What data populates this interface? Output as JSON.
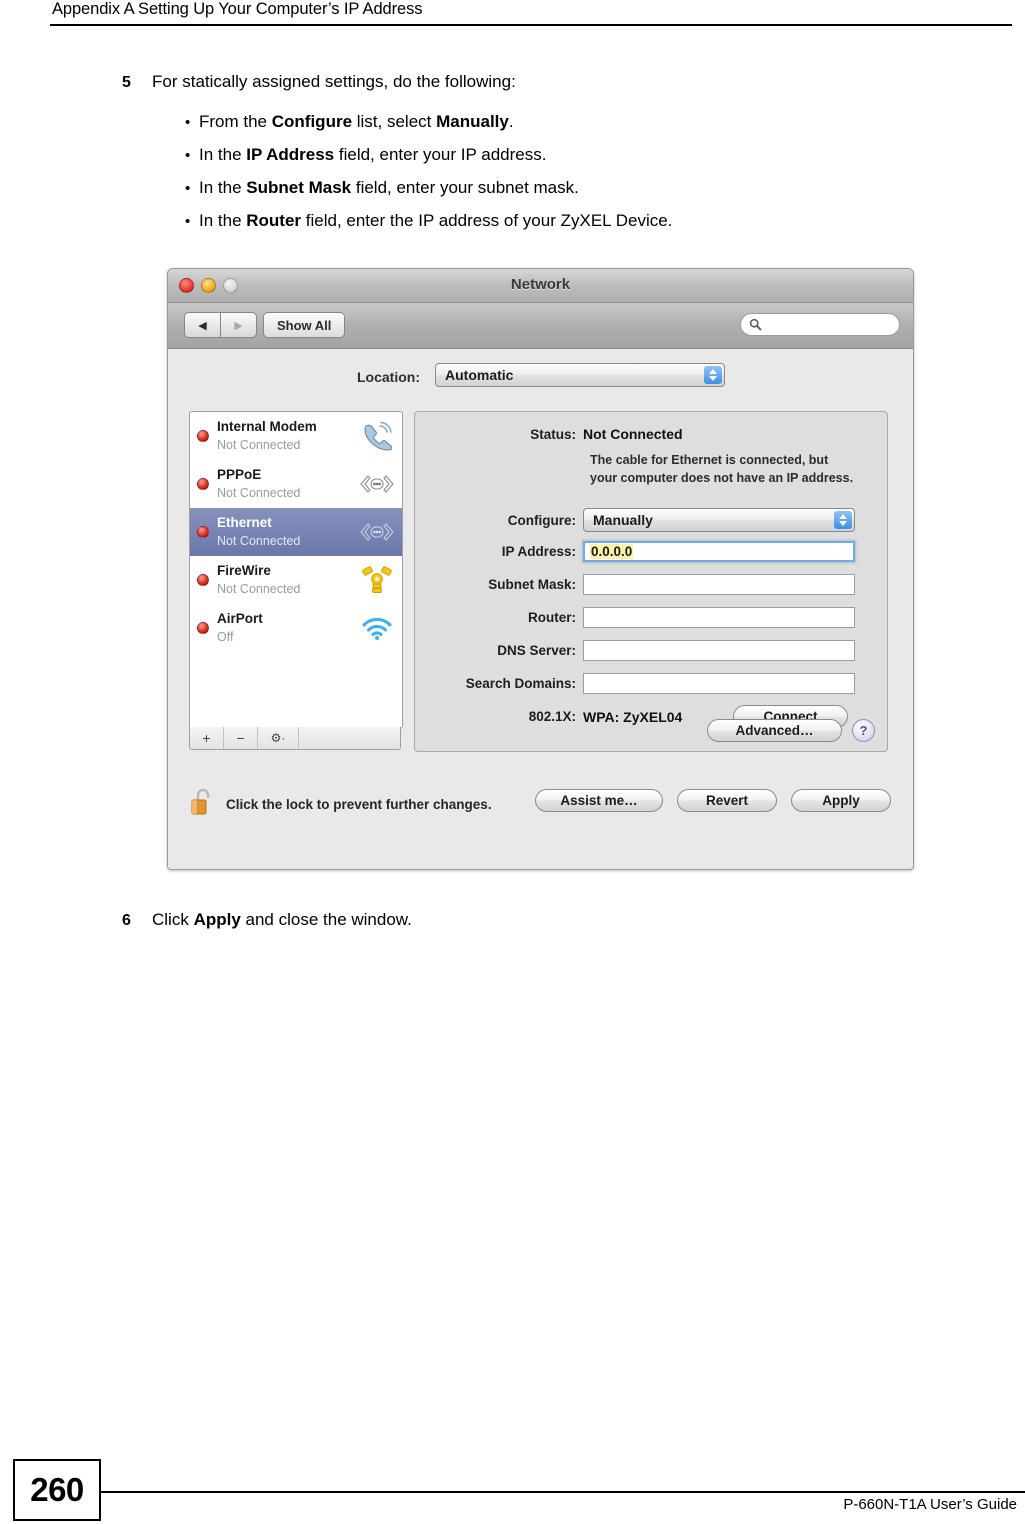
{
  "page_header": {
    "title": "Appendix A Setting Up Your Computer’s IP Address"
  },
  "steps": {
    "step5": {
      "number": "5",
      "text": "For statically assigned settings, do the following:",
      "bullets": [
        {
          "dot": "•",
          "pre": "From the ",
          "bold1": "Configure",
          "mid": " list, select ",
          "bold2": "Manually",
          "post": "."
        },
        {
          "dot": "•",
          "pre": "In the ",
          "bold1": "IP Address",
          "mid": " field, enter your IP address.",
          "bold2": "",
          "post": ""
        },
        {
          "dot": "•",
          "pre": "In the ",
          "bold1": "Subnet Mask",
          "mid": " field, enter your subnet mask.",
          "bold2": "",
          "post": ""
        },
        {
          "dot": "•",
          "pre": "In the ",
          "bold1": "Router",
          "mid": " field, enter the IP address of your ZyXEL Device.",
          "bold2": "",
          "post": ""
        }
      ]
    },
    "step6": {
      "number": "6",
      "pre": "Click ",
      "bold": "Apply",
      "post": " and close the window."
    }
  },
  "network_window": {
    "title": "Network",
    "traffic_lights": {
      "close": "close-button",
      "minimize": "minimize-button",
      "zoom": "zoom-button"
    },
    "toolbar": {
      "back_glyph": "◀",
      "forward_glyph": "▶",
      "show_all_label": "Show All",
      "search_placeholder": "",
      "search_icon": "search-icon"
    },
    "location": {
      "label": "Location:",
      "value": "Automatic"
    },
    "interfaces": [
      {
        "name": "Internal Modem",
        "state": "Not Connected",
        "icon": "modem-icon",
        "selected": false
      },
      {
        "name": "PPPoE",
        "state": "Not Connected",
        "icon": "pppoe-icon",
        "selected": false
      },
      {
        "name": "Ethernet",
        "state": "Not Connected",
        "icon": "ethernet-icon",
        "selected": true
      },
      {
        "name": "FireWire",
        "state": "Not Connected",
        "icon": "firewire-icon",
        "selected": false
      },
      {
        "name": "AirPort",
        "state": "Off",
        "icon": "airport-icon",
        "selected": false
      }
    ],
    "sidebar_toolbar": {
      "add": "+",
      "remove": "−",
      "gear": "⚙·"
    },
    "panel": {
      "status_label": "Status:",
      "status_value": "Not Connected",
      "status_desc_line1": "The cable for Ethernet is connected, but",
      "status_desc_line2": "your computer does not have an IP address.",
      "configure_label": "Configure:",
      "configure_value": "Manually",
      "ip_label": "IP Address:",
      "ip_value": "0.0.0.0",
      "subnet_label": "Subnet Mask:",
      "subnet_value": "",
      "router_label": "Router:",
      "router_value": "",
      "dns_label": "DNS Server:",
      "dns_value": "",
      "search_domains_label": "Search Domains:",
      "search_domains_value": "",
      "dot1x_label": "802.1X:",
      "dot1x_value": "WPA: ZyXEL04",
      "connect_label": "Connect",
      "advanced_label": "Advanced…",
      "help_label": "?"
    },
    "footer": {
      "lock_icon": "lock-open-icon",
      "lock_text": "Click the lock to prevent further changes.",
      "assist_label": "Assist me…",
      "revert_label": "Revert",
      "apply_label": "Apply"
    }
  },
  "page_footer": {
    "page_number": "260",
    "guide_title": "P-660N-T1A User’s Guide"
  },
  "colors": {
    "selection_blue": "#6a77ab",
    "led_red": "#da2b22",
    "popup_arrow_blue": "#3d90e4",
    "ip_highlight_yellow": "#fdf2a8",
    "window_bg": "#e9e9e9"
  }
}
